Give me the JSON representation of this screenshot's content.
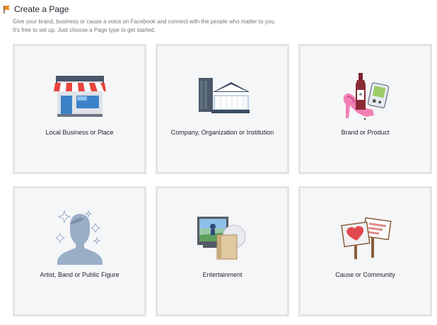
{
  "header": {
    "title": "Create a Page",
    "subtitle_line1": "Give your brand, business or cause a voice on Facebook and connect with the people who matter to you.",
    "subtitle_line2": "It's free to set up. Just choose a Page type to get started."
  },
  "categories": [
    {
      "label": "Local Business or Place",
      "icon": "storefront-icon"
    },
    {
      "label": "Company, Organization or Institution",
      "icon": "building-icon"
    },
    {
      "label": "Brand or Product",
      "icon": "products-icon"
    },
    {
      "label": "Artist, Band or Public Figure",
      "icon": "person-silhouette-icon"
    },
    {
      "label": "Entertainment",
      "icon": "media-icon"
    },
    {
      "label": "Cause or Community",
      "icon": "signs-icon"
    }
  ],
  "colors": {
    "card_bg": "#f5f6f7",
    "card_border": "#e3e4e6",
    "subtitle": "#6f7680"
  }
}
